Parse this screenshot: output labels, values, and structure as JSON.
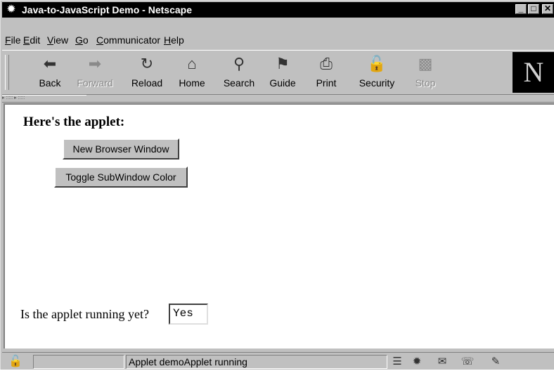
{
  "window": {
    "title": "Java-to-JavaScript Demo - Netscape",
    "controls": {
      "minimize": "_",
      "maximize": "□",
      "close": "✕"
    }
  },
  "menu": {
    "items": [
      {
        "key": "F",
        "rest": "ile"
      },
      {
        "key": "E",
        "rest": "dit"
      },
      {
        "key": "V",
        "rest": "iew"
      },
      {
        "key": "G",
        "rest": "o"
      },
      {
        "key": "C",
        "rest": "ommunicator"
      },
      {
        "key": "H",
        "rest": "elp"
      }
    ]
  },
  "toolbar": {
    "buttons": [
      {
        "label": "Back",
        "icon": "back-arrow-icon",
        "glyph": "⬅",
        "enabled": true
      },
      {
        "label": "Forward",
        "icon": "forward-arrow-icon",
        "glyph": "➡",
        "enabled": false
      },
      {
        "label": "Reload",
        "icon": "reload-icon",
        "glyph": "↻",
        "enabled": true
      },
      {
        "label": "Home",
        "icon": "home-icon",
        "glyph": "⌂",
        "enabled": true
      },
      {
        "label": "Search",
        "icon": "search-icon",
        "glyph": "⚲",
        "enabled": true
      },
      {
        "label": "Guide",
        "icon": "guide-icon",
        "glyph": "⚑",
        "enabled": true
      },
      {
        "label": "Print",
        "icon": "print-icon",
        "glyph": "⎙",
        "enabled": true
      },
      {
        "label": "Security",
        "icon": "security-lock-icon",
        "glyph": "🔓",
        "enabled": true
      },
      {
        "label": "Stop",
        "icon": "stop-icon",
        "glyph": "▩",
        "enabled": false
      }
    ],
    "logo": "N"
  },
  "page": {
    "heading": "Here's the applet:",
    "buttons": {
      "new_window": "New Browser Window",
      "toggle_color": "Toggle SubWindow Color"
    },
    "question": "Is the applet running yet?",
    "answer": "Yes"
  },
  "status": {
    "text": "Applet demoApplet running"
  }
}
